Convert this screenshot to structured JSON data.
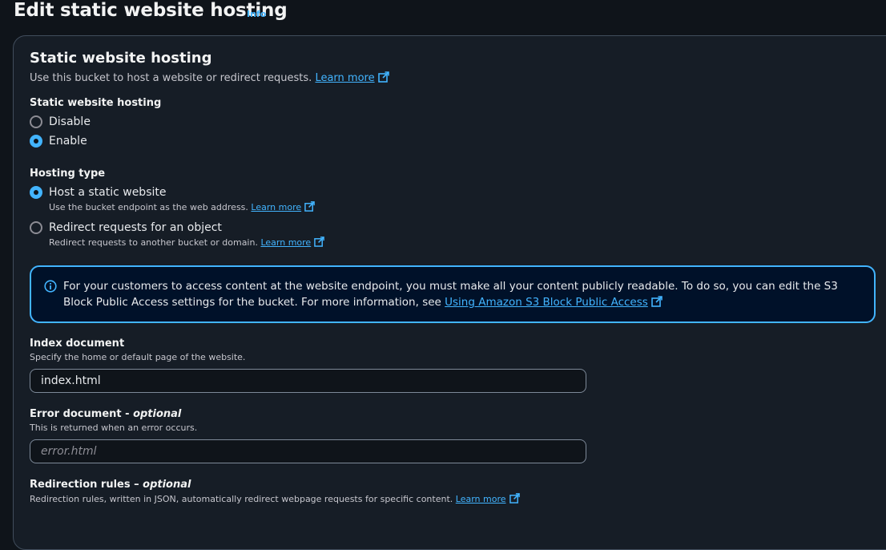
{
  "header": {
    "title": "Edit static website hosting",
    "info": "Info"
  },
  "section": {
    "title": "Static website hosting",
    "description": "Use this bucket to host a website or redirect requests.",
    "learn_more": "Learn more"
  },
  "hosting": {
    "label": "Static website hosting",
    "options": [
      {
        "label": "Disable",
        "selected": false
      },
      {
        "label": "Enable",
        "selected": true
      }
    ]
  },
  "hosting_type": {
    "label": "Hosting type",
    "options": [
      {
        "label": "Host a static website",
        "description": "Use the bucket endpoint as the web address.",
        "learn_more": "Learn more",
        "selected": true
      },
      {
        "label": "Redirect requests for an object",
        "description": "Redirect requests to another bucket or domain.",
        "learn_more": "Learn more",
        "selected": false
      }
    ]
  },
  "alert": {
    "text": "For your customers to access content at the website endpoint, you must make all your content publicly readable. To do so, you can edit the S3 Block Public Access settings for the bucket. For more information, see",
    "link": "Using Amazon S3 Block Public Access"
  },
  "index_document": {
    "label": "Index document",
    "description": "Specify the home or default page of the website.",
    "value": "index.html"
  },
  "error_document": {
    "label": "Error document -",
    "optional": "optional",
    "description": "This is returned when an error occurs.",
    "placeholder": "error.html"
  },
  "redirection_rules": {
    "label": "Redirection rules –",
    "optional": "optional",
    "description": "Redirection rules, written in JSON, automatically redirect webpage requests for specific content.",
    "learn_more": "Learn more"
  },
  "colors": {
    "accent": "#42b4ff",
    "background": "#0f141a",
    "panel": "#161d26"
  },
  "icons": [
    "external-link-icon",
    "info-circle-icon"
  ]
}
